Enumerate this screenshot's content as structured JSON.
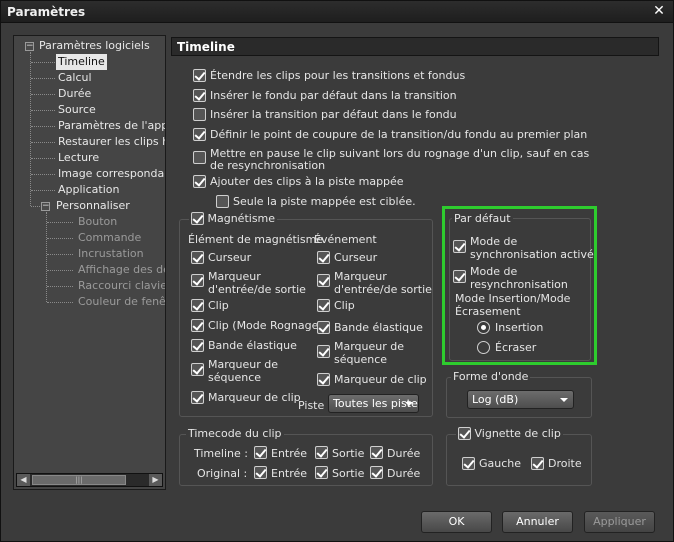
{
  "window": {
    "title": "Paramètres",
    "close_icon": "close-icon"
  },
  "tree": {
    "root": "Paramètres logiciels",
    "items": [
      "Timeline",
      "Calcul",
      "Durée",
      "Source",
      "Paramètres de l'appar",
      "Restaurer les clips hor",
      "Lecture",
      "Image correspondante",
      "Application"
    ],
    "personalize": "Personnaliser",
    "sub_items": [
      "Bouton",
      "Commande",
      "Incrustation",
      "Affichage des déta",
      "Raccourci clavier",
      "Couleur de fenêtre"
    ]
  },
  "panel": {
    "title": "Timeline"
  },
  "options": [
    {
      "label": "Étendre les clips pour les transitions et fondus",
      "checked": true
    },
    {
      "label": "Insérer le fondu par défaut dans la transition",
      "checked": true
    },
    {
      "label": "Insérer la transition par défaut dans le fondu",
      "checked": false
    },
    {
      "label": "Définir le point de coupure de la transition/du fondu au premier plan",
      "checked": true
    },
    {
      "label": "Mettre en pause le clip suivant lors du rognage d'un clip, sauf en cas",
      "label2": "de resynchronisation",
      "checked": false
    },
    {
      "label": "Ajouter des clips à la piste mappée",
      "checked": true
    }
  ],
  "sub_option": {
    "label": "Seule la piste mappée est ciblée.",
    "checked": false
  },
  "magnetism": {
    "title": "Magnétisme",
    "col1_header": "Élément de magnétisme",
    "col2_header": "Événement",
    "col1": [
      {
        "label": "Curseur"
      },
      {
        "label": "Marqueur",
        "label2": "d'entrée/de sortie"
      },
      {
        "label": "Clip"
      },
      {
        "label": "Clip (Mode Rognage)"
      },
      {
        "label": "Bande élastique"
      },
      {
        "label": "Marqueur de",
        "label2": "séquence"
      },
      {
        "label": "Marqueur de clip"
      }
    ],
    "col2": [
      {
        "label": "Curseur"
      },
      {
        "label": "Marqueur",
        "label2": "d'entrée/de sortie"
      },
      {
        "label": "Clip"
      },
      {
        "label": "Bande élastique"
      },
      {
        "label": "Marqueur de",
        "label2": "séquence"
      },
      {
        "label": "Marqueur de clip"
      }
    ],
    "piste_label": "Piste",
    "piste_value": "Toutes les piste"
  },
  "default_group": {
    "title": "Par défaut",
    "sync_label1": "Mode de",
    "sync_label2": "synchronisation activé",
    "resync_label1": "Mode de",
    "resync_label2": "resynchronisation",
    "mode_label1": "Mode Insertion/Mode",
    "mode_label2": "Écrasement",
    "radio_insert": "Insertion",
    "radio_overwrite": "Écraser"
  },
  "waveform": {
    "title": "Forme d'onde",
    "value": "Log (dB)"
  },
  "timecode": {
    "title": "Timecode du clip",
    "row1": "Timeline :",
    "row2": "Original :",
    "entree": "Entrée",
    "sortie": "Sortie",
    "duree": "Durée"
  },
  "thumbnail": {
    "title": "Vignette de clip",
    "left": "Gauche",
    "right": "Droite"
  },
  "buttons": {
    "ok": "OK",
    "cancel": "Annuler",
    "apply": "Appliquer"
  },
  "colors": {
    "highlight": "#2ecc2e",
    "background": "#3b3b3b"
  }
}
